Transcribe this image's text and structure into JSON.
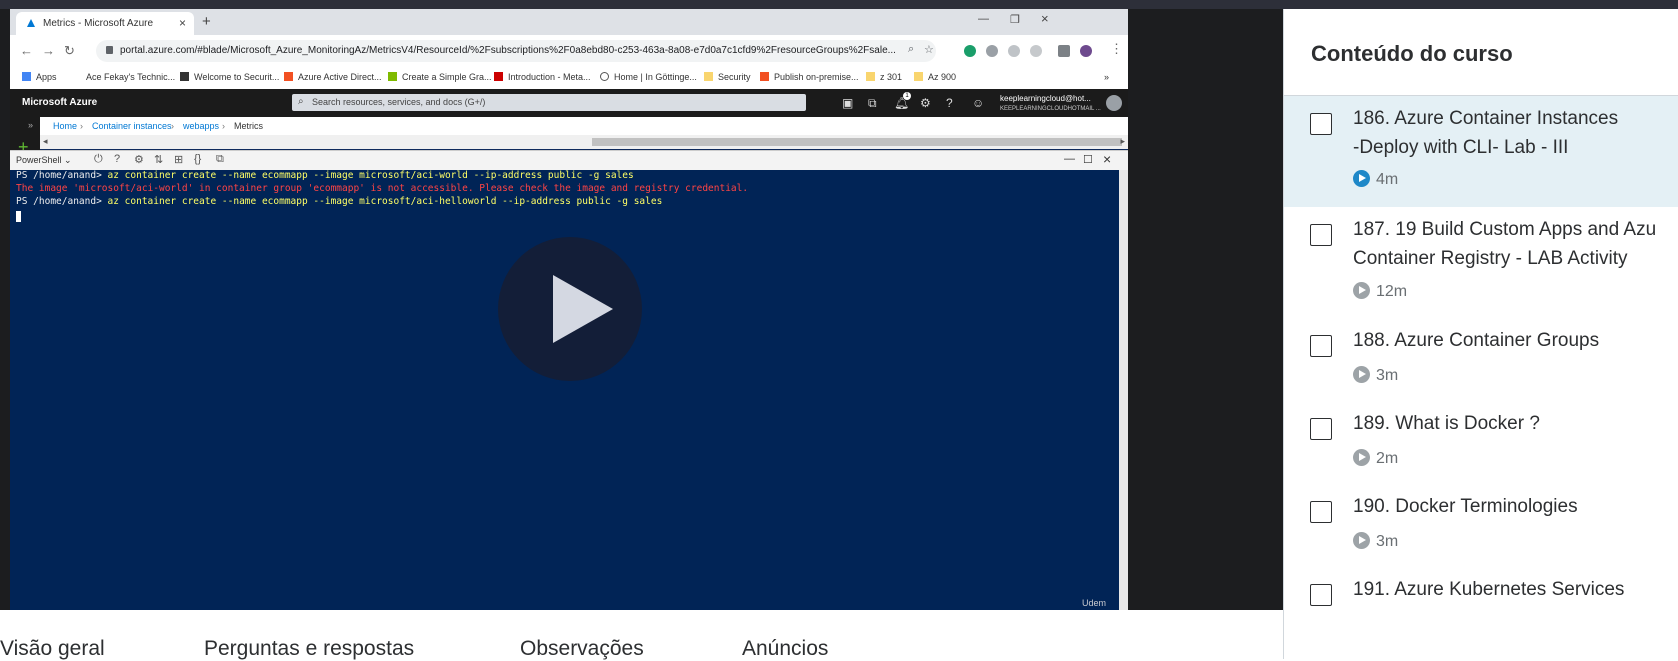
{
  "browser": {
    "tab_title": "Metrics - Microsoft Azure",
    "url": "portal.azure.com/#blade/Microsoft_Azure_MonitoringAz/MetricsV4/ResourceId/%2Fsubscriptions%2F0a8ebd80-c253-463a-8a08-e7d0a7c1cfd9%2FresourceGroups%2Fsale...",
    "bookmarks": [
      "Apps",
      "Ace Fekay's Technic...",
      "Welcome to Securit...",
      "Azure Active Direct...",
      "Create a Simple Gra...",
      "Introduction - Meta...",
      "Home | In Göttinge...",
      "Security",
      "Publish on-premise...",
      "z 301",
      "Az 900"
    ],
    "more_bookmarks": "»"
  },
  "azure": {
    "brand": "Microsoft Azure",
    "search_placeholder": "Search resources, services, and docs (G+/)",
    "user_email": "keeplearningcloud@hot...",
    "user_directory": "KEEPLEARNINGCLOUDHOTMAIL ...",
    "notification_count": "1",
    "breadcrumb": [
      "Home",
      "Container instances",
      "webapps",
      "Metrics"
    ],
    "shell_selector": "PowerShell"
  },
  "terminal": {
    "lines": [
      {
        "prompt": "PS /home/anand>",
        "cmd": " az container create --name ecommapp --image microsoft/aci-world --ip-address public -g sales",
        "type": "cmd"
      },
      {
        "text": "The image 'microsoft/aci-world' in container group 'ecommapp' is not accessible. Please check the image and registry credential.",
        "type": "error"
      },
      {
        "prompt": "PS /home/anand>",
        "cmd": " az container create --name ecommapp --image microsoft/aci-helloworld --ip-address public -g sales",
        "type": "cmd"
      }
    ]
  },
  "watermark": "Udem",
  "course_tabs": [
    "Visão geral",
    "Perguntas e respostas",
    "Observações",
    "Anúncios"
  ],
  "sidebar": {
    "title": "Conteúdo do curso",
    "lectures": [
      {
        "line1": "186. Azure Container Instances",
        "line2": "-Deploy with CLI- Lab - III",
        "duration": "4m",
        "active": true
      },
      {
        "line1": "187. 19 Build Custom Apps and Azu",
        "line2": "Container Registry - LAB Activity",
        "duration": "12m",
        "active": false
      },
      {
        "line1": "188. Azure Container Groups",
        "line2": "",
        "duration": "3m",
        "active": false
      },
      {
        "line1": "189. What is Docker ?",
        "line2": "",
        "duration": "2m",
        "active": false
      },
      {
        "line1": "190. Docker Terminologies",
        "line2": "",
        "duration": "3m",
        "active": false
      },
      {
        "line1": "191. Azure Kubernetes Services",
        "line2": "",
        "duration": "",
        "active": false
      }
    ]
  },
  "colors": {
    "terminal_bg": "#012456",
    "error_text": "#ff4444",
    "active_lecture_bg": "#e4f0f5",
    "azure_link": "#0078d4"
  }
}
